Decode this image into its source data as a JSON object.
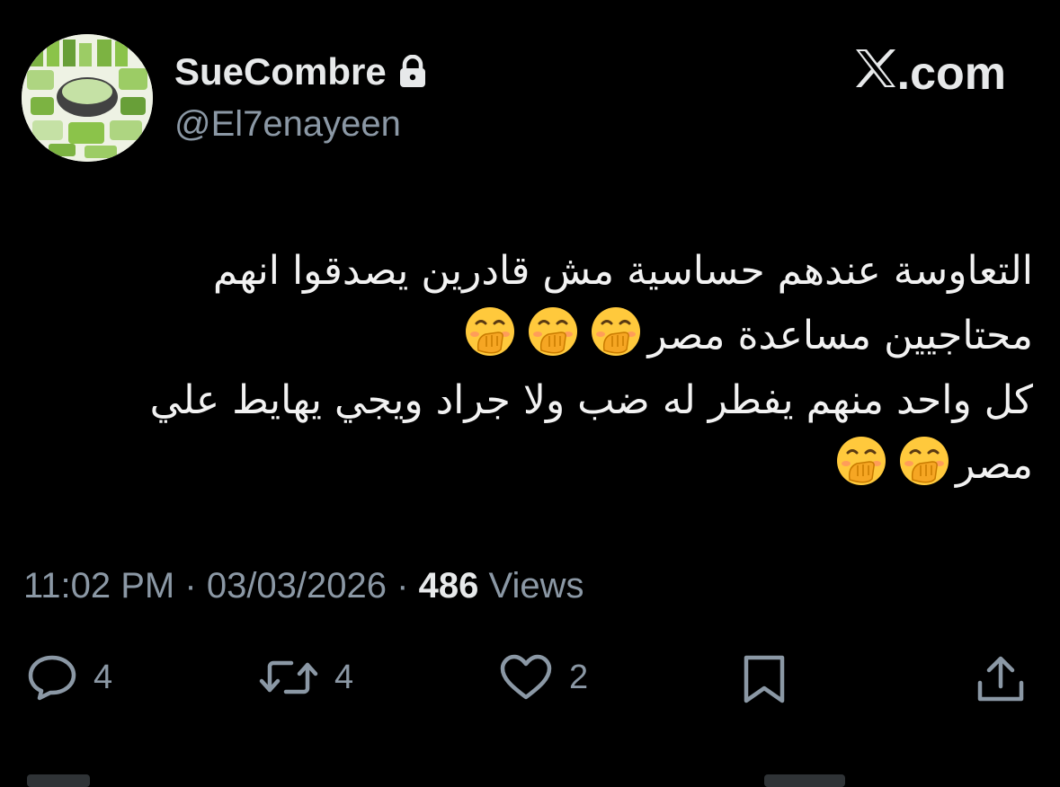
{
  "user": {
    "display_name": "SueCombre",
    "handle": "@El7enayeen",
    "locked_icon": "lock-icon",
    "avatar_icon": "food-platter-avatar"
  },
  "brand": {
    "logo": "x-logo-icon",
    "domain_text": ".com"
  },
  "tweet": {
    "lines": [
      "التعاوسة عندهم حساسية مش قادرين يصدقوا انهم",
      "محتاجيين مساعدة مصر",
      "كل واحد منهم يفطر له ضب ولا جراد ويجي يهايط علي",
      "مصر"
    ],
    "emoji_name": "face-with-hand-over-mouth-emoji"
  },
  "meta": {
    "time": "11:02 PM",
    "separator": "·",
    "date": "03/03/2026",
    "views_count": "486",
    "views_label": "Views"
  },
  "actions": {
    "replies": "4",
    "reposts": "4",
    "likes": "2"
  },
  "colors": {
    "background": "#000000",
    "primary_text": "#e7e9ea",
    "secondary_text": "#8b98a5"
  }
}
